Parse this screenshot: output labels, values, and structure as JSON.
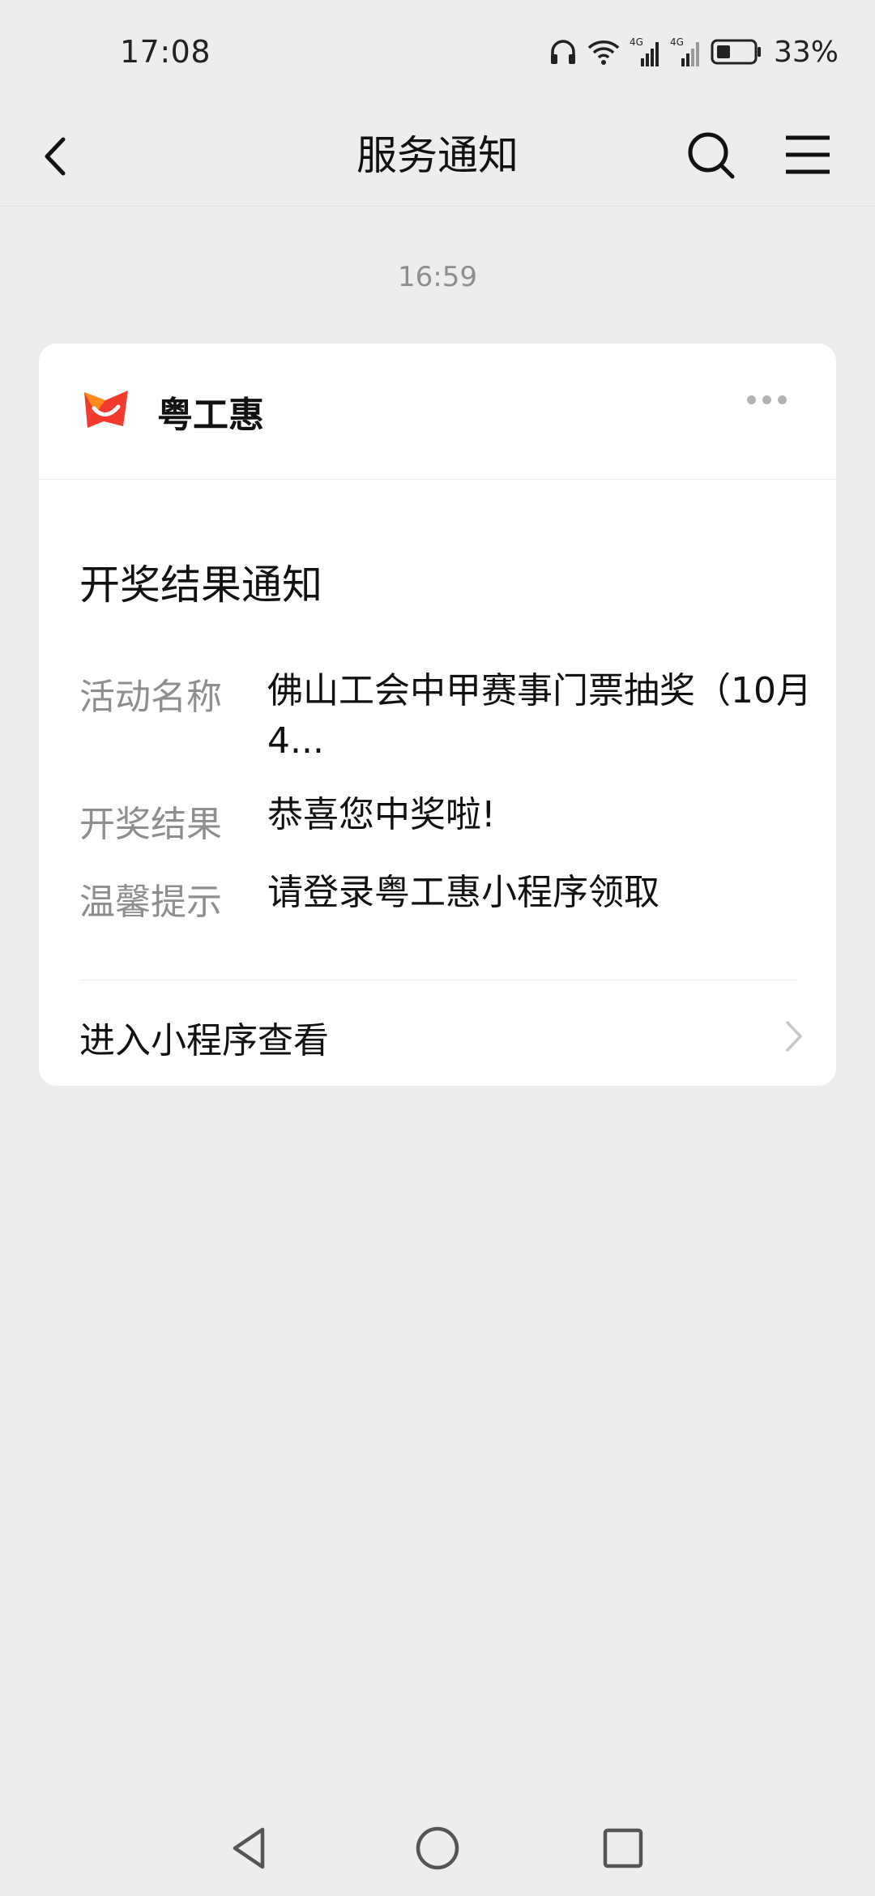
{
  "status_bar": {
    "time": "17:08",
    "network_1": "4G",
    "network_2": "4G",
    "battery_percent": "33%"
  },
  "nav": {
    "title": "服务通知",
    "icons": [
      "back-arrow-icon",
      "search-icon",
      "menu-icon"
    ]
  },
  "message": {
    "time": "16:59"
  },
  "card": {
    "app_name": "粤工惠",
    "app_logo": "yuegonghui-logo",
    "title": "开奖结果通知",
    "fields": [
      {
        "label": "活动名称",
        "value": "佛山工会中甲赛事门票抽奖（10月4..."
      },
      {
        "label": "开奖结果",
        "value": "恭喜您中奖啦!"
      },
      {
        "label": "温馨提示",
        "value": "请登录粤工惠小程序领取"
      }
    ],
    "footer_label": "进入小程序查看"
  },
  "system_nav": {
    "icons": [
      "back-triangle-icon",
      "home-circle-icon",
      "recents-square-icon"
    ]
  },
  "colors": {
    "background": "#EDEDED",
    "card": "#FFFFFF",
    "secondary_text": "#8E8E8E",
    "logo_red": "#F23A2E",
    "logo_orange": "#FF8A1E"
  }
}
